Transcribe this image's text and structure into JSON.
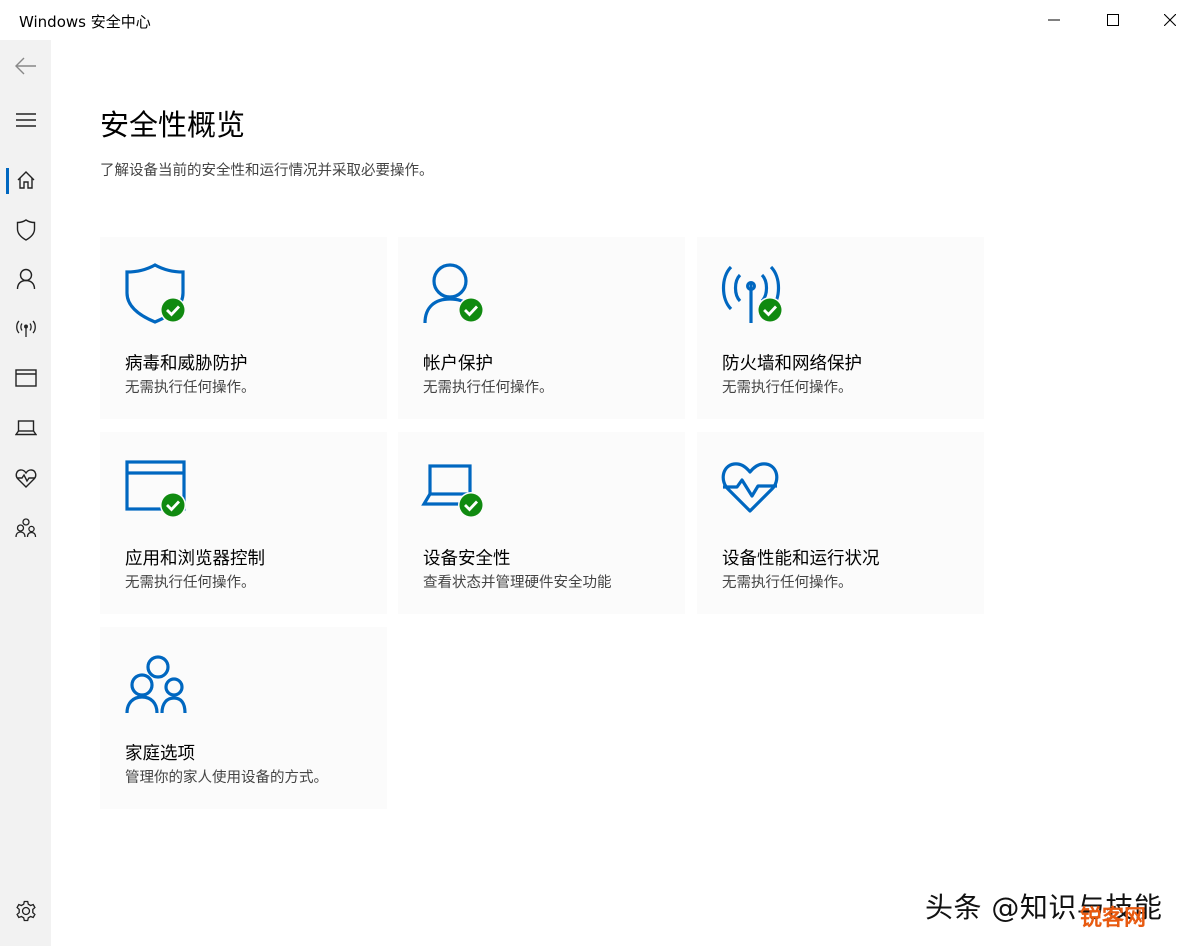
{
  "window": {
    "title": "Windows 安全中心"
  },
  "colors": {
    "accent": "#0067c0",
    "check_green": "#108a10",
    "sidebar_bg": "#f2f2f2",
    "tile_bg": "#fbfbfb"
  },
  "sidebar": {
    "items": [
      {
        "name": "back",
        "icon": "back-arrow-icon"
      },
      {
        "name": "menu",
        "icon": "hamburger-menu-icon"
      },
      {
        "name": "home",
        "icon": "home-icon",
        "selected": true
      },
      {
        "name": "virus",
        "icon": "shield-icon"
      },
      {
        "name": "account",
        "icon": "person-icon"
      },
      {
        "name": "firewall",
        "icon": "antenna-icon"
      },
      {
        "name": "app-browser",
        "icon": "browser-window-icon"
      },
      {
        "name": "device-security",
        "icon": "laptop-icon"
      },
      {
        "name": "device-health",
        "icon": "heart-pulse-icon"
      },
      {
        "name": "family",
        "icon": "family-icon"
      },
      {
        "name": "settings",
        "icon": "gear-icon"
      }
    ]
  },
  "main": {
    "title": "安全性概览",
    "subtitle": "了解设备当前的安全性和运行情况并采取必要操作。",
    "tiles": [
      {
        "title": "病毒和威胁防护",
        "desc": "无需执行任何操作。",
        "icon": "shield-icon"
      },
      {
        "title": "帐户保护",
        "desc": "无需执行任何操作。",
        "icon": "person-icon"
      },
      {
        "title": "防火墙和网络保护",
        "desc": "无需执行任何操作。",
        "icon": "antenna-icon"
      },
      {
        "title": "应用和浏览器控制",
        "desc": "无需执行任何操作。",
        "icon": "browser-window-icon"
      },
      {
        "title": "设备安全性",
        "desc": "查看状态并管理硬件安全功能",
        "icon": "laptop-icon"
      },
      {
        "title": "设备性能和运行状况",
        "desc": "无需执行任何操作。",
        "icon": "heart-pulse-icon"
      },
      {
        "title": "家庭选项",
        "desc": "管理你的家人使用设备的方式。",
        "icon": "family-icon"
      }
    ]
  },
  "watermark": {
    "text": "头条 @知识与技能",
    "text2": "锐客网"
  }
}
